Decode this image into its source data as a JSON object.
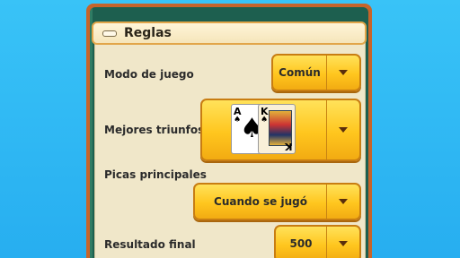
{
  "section": {
    "title": "Reglas"
  },
  "rows": {
    "game_mode": {
      "label": "Modo de juego",
      "value": "Común"
    },
    "best_trumps": {
      "label": "Mejores triunfos",
      "cards": [
        {
          "rank": "A",
          "suit": "♠"
        },
        {
          "rank": "K",
          "suit": "♠"
        }
      ]
    },
    "main_spades": {
      "label": "Picas principales",
      "value": "Cuando se jugó"
    },
    "final_score": {
      "label": "Resultado final",
      "value": "500"
    }
  },
  "colors": {
    "background": "#2bb4f2",
    "panel_border": "#c7642a",
    "dropdown": "#ffc61e"
  }
}
